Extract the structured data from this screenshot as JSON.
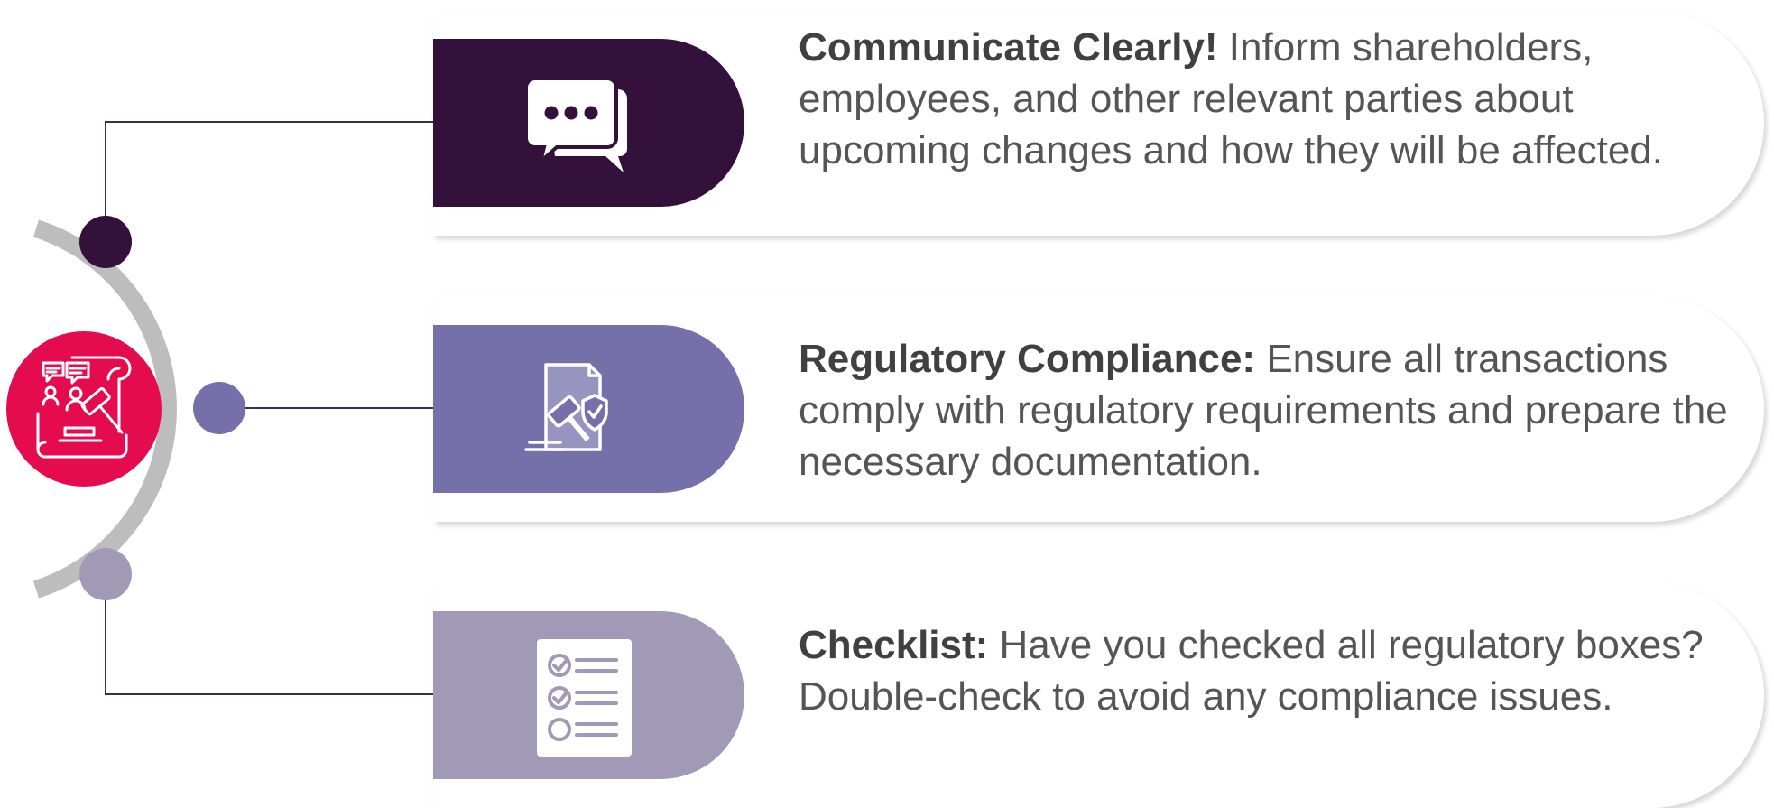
{
  "colors": {
    "dark_purple": "#34113A",
    "medium_purple": "#7570AA",
    "light_purple": "#A299B6",
    "hub_red": "#E40B4F",
    "arc_gray": "#BDBDBD",
    "connector": "#3D2A5E"
  },
  "hub": {
    "icon": "legal-meeting-gavel-icon"
  },
  "items": [
    {
      "title": "Communicate Clearly!",
      "body": " Inform shareholders, employees, and other relevant parties about upcoming changes and how they will be affected.",
      "icon": "chat-bubbles-icon"
    },
    {
      "title": "Regulatory Compliance:",
      "body": " Ensure all transactions comply with regulatory requirements and prepare the necessary documentation.",
      "icon": "document-gavel-shield-icon"
    },
    {
      "title": "Checklist:",
      "body": " Have you checked all regulatory boxes? Double-check to avoid any compliance issues.",
      "icon": "checklist-icon"
    }
  ]
}
